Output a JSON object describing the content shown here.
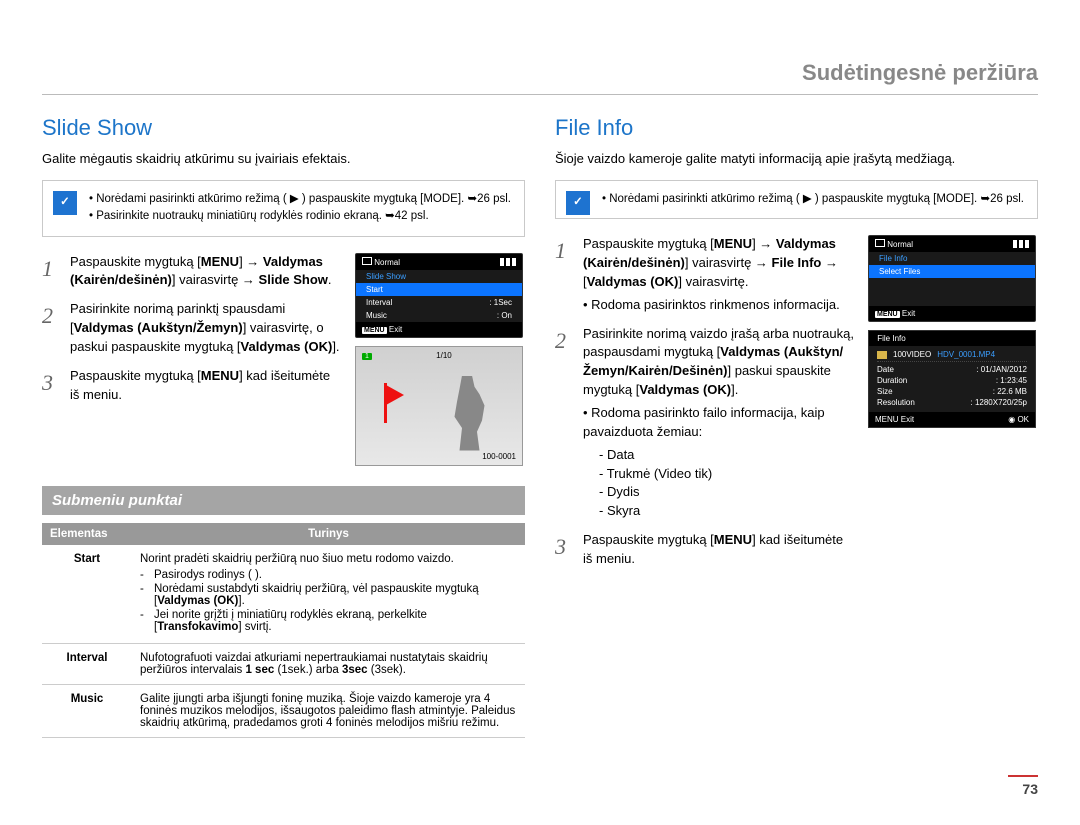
{
  "header": {
    "title": "Sudėtingesnė peržiūra"
  },
  "page_number": "73",
  "left": {
    "title": "Slide Show",
    "intro": "Galite mėgautis skaidrių atkūrimu su įvairiais efektais.",
    "info_items": [
      "Norėdami pasirinkti atkūrimo režimą ( ▶ ) paspauskite mygtuką [MODE]. ➥26 psl.",
      "Pasirinkite nuotraukų miniatiūrų rodyklės rodinio ekraną. ➥42 psl."
    ],
    "steps": [
      {
        "n": "1",
        "html": "Paspauskite mygtuką [<b>MENU</b>] → <b>Valdymas (Kairėn/dešinėn)</b>] vairasvirtę → <b>Slide Show</b>."
      },
      {
        "n": "2",
        "html": "Pasirinkite norimą parinktį spausdami [<b>Valdymas (Aukštyn/Žemyn)</b>] vairasvirtę, o paskui paspauskite mygtuką [<b>Valdymas (OK)</b>]."
      },
      {
        "n": "3",
        "html": "Paspauskite mygtuką [<b>MENU</b>] kad išeitumėte iš meniu."
      }
    ],
    "submenu_heading": "Submeniu punktai",
    "table_headers": {
      "item": "Elementas",
      "content": "Turinys"
    },
    "table": [
      {
        "item": "Start",
        "lead": "Norint pradėti skaidrių peržiūrą nuo šiuo metu rodomo vaizdo.",
        "bullets": [
          "Pasirodys rodinys (  ).",
          "Norėdami sustabdyti skaidrių peržiūrą, vėl paspauskite mygtuką [<b>Valdymas (OK)</b>].",
          "Jei norite grįžti į miniatiūrų rodyklės ekraną, perkelkite [<b>Transfokavimo</b>] svirtį."
        ]
      },
      {
        "item": "Interval",
        "lead": "Nufotografuoti vaizdai atkuriami nepertraukiamai nustatytais skaidrių peržiūros intervalais <b>1 sec</b> (1sek.) arba <b>3sec</b> (3sek).",
        "bullets": []
      },
      {
        "item": "Music",
        "lead": "Galite įjungti arba išjungti foninę muziką. Šioje vaizdo kameroje yra 4 foninės muzikos melodijos, išsaugotos paleidimo flash atmintyje. Paleidus skaidrių atkūrimą, pradedamos groti 4 foninės melodijos mišriu režimu.",
        "bullets": []
      }
    ],
    "osd_menu": {
      "top": "Normal",
      "section": "Slide Show",
      "items": [
        {
          "label": "Start",
          "val": "",
          "hl": true
        },
        {
          "label": "Interval",
          "val": ": 1Sec"
        },
        {
          "label": "Music",
          "val": ": On"
        }
      ],
      "exit": "Exit",
      "menu": "MENU"
    },
    "osd_image": {
      "counter": "1/10",
      "fileno": "100-0001",
      "badge": "1"
    }
  },
  "right": {
    "title": "File Info",
    "intro": "Šioje vaizdo kameroje galite matyti informaciją apie įrašytą medžiagą.",
    "info_items": [
      "Norėdami pasirinkti atkūrimo režimą ( ▶ ) paspauskite mygtuką [MODE]. ➥26 psl."
    ],
    "steps": [
      {
        "n": "1",
        "html": "Paspauskite mygtuką [<b>MENU</b>] → <b>Valdymas (Kairėn/dešinėn)</b>] vairasvirtę → <b>File Info</b> → [<b>Valdymas (OK)</b>] vairasvirtę.",
        "sub": [
          "Rodoma pasirinktos rinkmenos informacija."
        ]
      },
      {
        "n": "2",
        "html": "Pasirinkite norimą vaizdo įrašą arba nuotrauką, paspausdami mygtuką [<b>Valdymas (Aukštyn/ Žemyn/Kairėn/Dešinėn)</b>] paskui spauskite mygtuką [<b>Valdymas (OK)</b>].",
        "sub": [
          "Rodoma pasirinkto failo informacija, kaip pavaizduota žemiau:"
        ],
        "sublist": [
          "Data",
          "Trukmė (Video tik)",
          "Dydis",
          "Skyra"
        ]
      },
      {
        "n": "3",
        "html": "Paspauskite mygtuką [<b>MENU</b>] kad išeitumėte iš meniu."
      }
    ],
    "osd_menu": {
      "top": "Normal",
      "section": "File Info",
      "items": [
        {
          "label": "Select Files",
          "val": "",
          "hl": true
        }
      ],
      "exit": "Exit",
      "menu": "MENU"
    },
    "osd_info": {
      "title": "File Info",
      "folder": "100VIDEO",
      "file": "HDV_0001.MP4",
      "rows": [
        {
          "k": "Date",
          "v": ": 01/JAN/2012"
        },
        {
          "k": "Duration",
          "v": ": 1:23:45"
        },
        {
          "k": "Size",
          "v": ": 22.6 MB"
        },
        {
          "k": "Resolution",
          "v": ": 1280X720/25p"
        }
      ],
      "exit": "Exit",
      "ok": "OK",
      "menu": "MENU"
    }
  }
}
